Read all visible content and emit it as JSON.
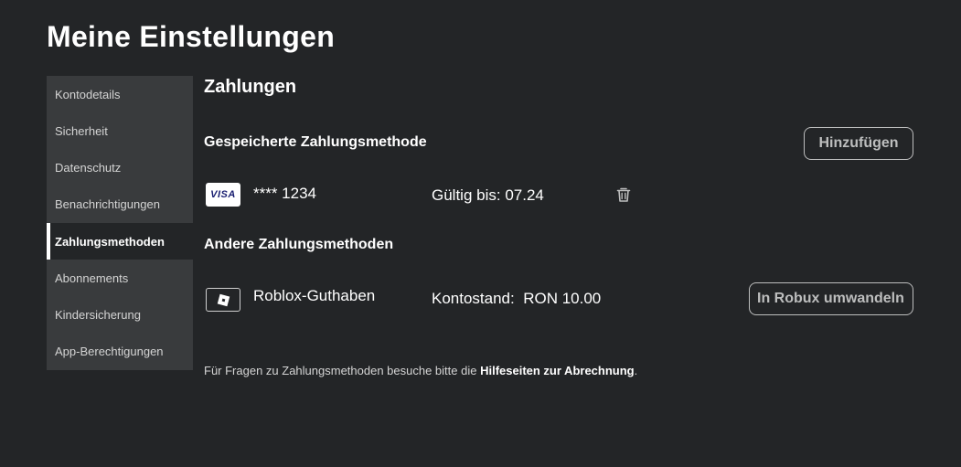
{
  "page": {
    "title": "Meine Einstellungen"
  },
  "sidebar": {
    "items": [
      {
        "label": "Kontodetails"
      },
      {
        "label": "Sicherheit"
      },
      {
        "label": "Datenschutz"
      },
      {
        "label": "Benachrichtigungen"
      },
      {
        "label": "Zahlungsmethoden",
        "active": true
      },
      {
        "label": "Abonnements"
      },
      {
        "label": "Kindersicherung"
      },
      {
        "label": "App-Berechtigungen"
      }
    ]
  },
  "payments": {
    "title": "Zahlungen",
    "saved_heading": "Gespeicherte Zahlungsmethode",
    "add_button": "Hinzufügen",
    "saved_card": {
      "brand": "VISA",
      "masked_number": "**** 1234",
      "valid_label": "Gültig bis:",
      "valid_value": "07.24",
      "delete_icon": "trash-icon"
    },
    "other_heading": "Andere Zahlungsmethoden",
    "credit": {
      "label": "Roblox-Guthaben",
      "balance_label": "Kontostand:",
      "balance_value": "RON 10.00",
      "convert_button": "In Robux umwandeln",
      "icon": "roblox-icon"
    },
    "footer": {
      "prefix": "Für Fragen zu Zahlungsmethoden besuche bitte die ",
      "link": "Hilfeseiten zur Abrechnung",
      "suffix": "."
    }
  },
  "colors": {
    "background": "#232527",
    "sidebar": "#393b3d",
    "text": "#ffffff",
    "muted_text": "#d4d4d4",
    "button_border": "#bdbebe"
  }
}
